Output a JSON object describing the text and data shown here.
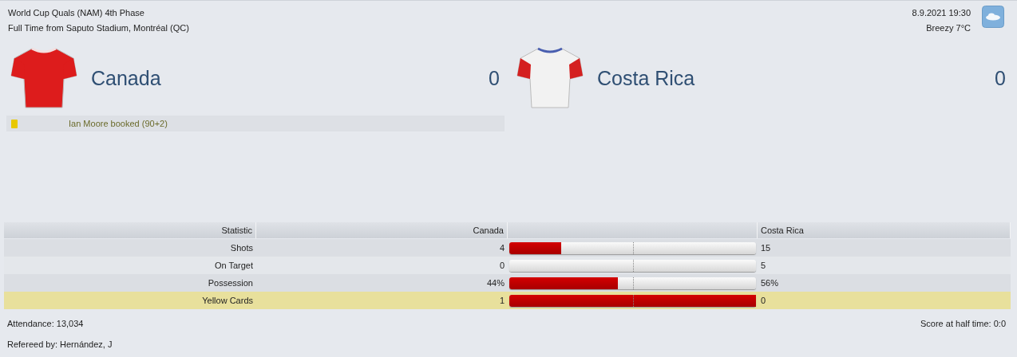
{
  "header": {
    "competition": "World Cup Quals (NAM) 4th Phase",
    "venue": "Full Time from Saputo Stadium, Montréal (QC)",
    "date": "8.9.2021 19:30",
    "weather": "Breezy 7°C"
  },
  "teams": [
    {
      "name": "Canada",
      "score": "0",
      "color": "#dd1c1c",
      "kind": "plain",
      "events": [
        {
          "kind": "yellow-card",
          "text": "Ian Moore booked (90+2)"
        }
      ]
    },
    {
      "name": "Costa Rica",
      "score": "0",
      "color": "#f2f2f2",
      "kind": "sleeved"
    }
  ],
  "stats": {
    "columns": [
      "Statistic",
      "Canada",
      "Costa Rica"
    ],
    "rows": [
      {
        "label": "Shots",
        "home": "4",
        "away": "15",
        "level": 0.21,
        "highlighted": false
      },
      {
        "label": "On Target",
        "home": "0",
        "away": "5",
        "level": 0,
        "highlighted": false
      },
      {
        "label": "Possession",
        "home": "44%",
        "away": "56%",
        "level": 0.44,
        "highlighted": false
      },
      {
        "label": "Yellow Cards",
        "home": "1",
        "away": "0",
        "level": 1,
        "highlighted": true
      }
    ]
  },
  "footer": {
    "attendance": "Attendance: 13,034",
    "half_time": "Score at half time: 0:0",
    "referee": "Refereed by: Hernández, J"
  }
}
